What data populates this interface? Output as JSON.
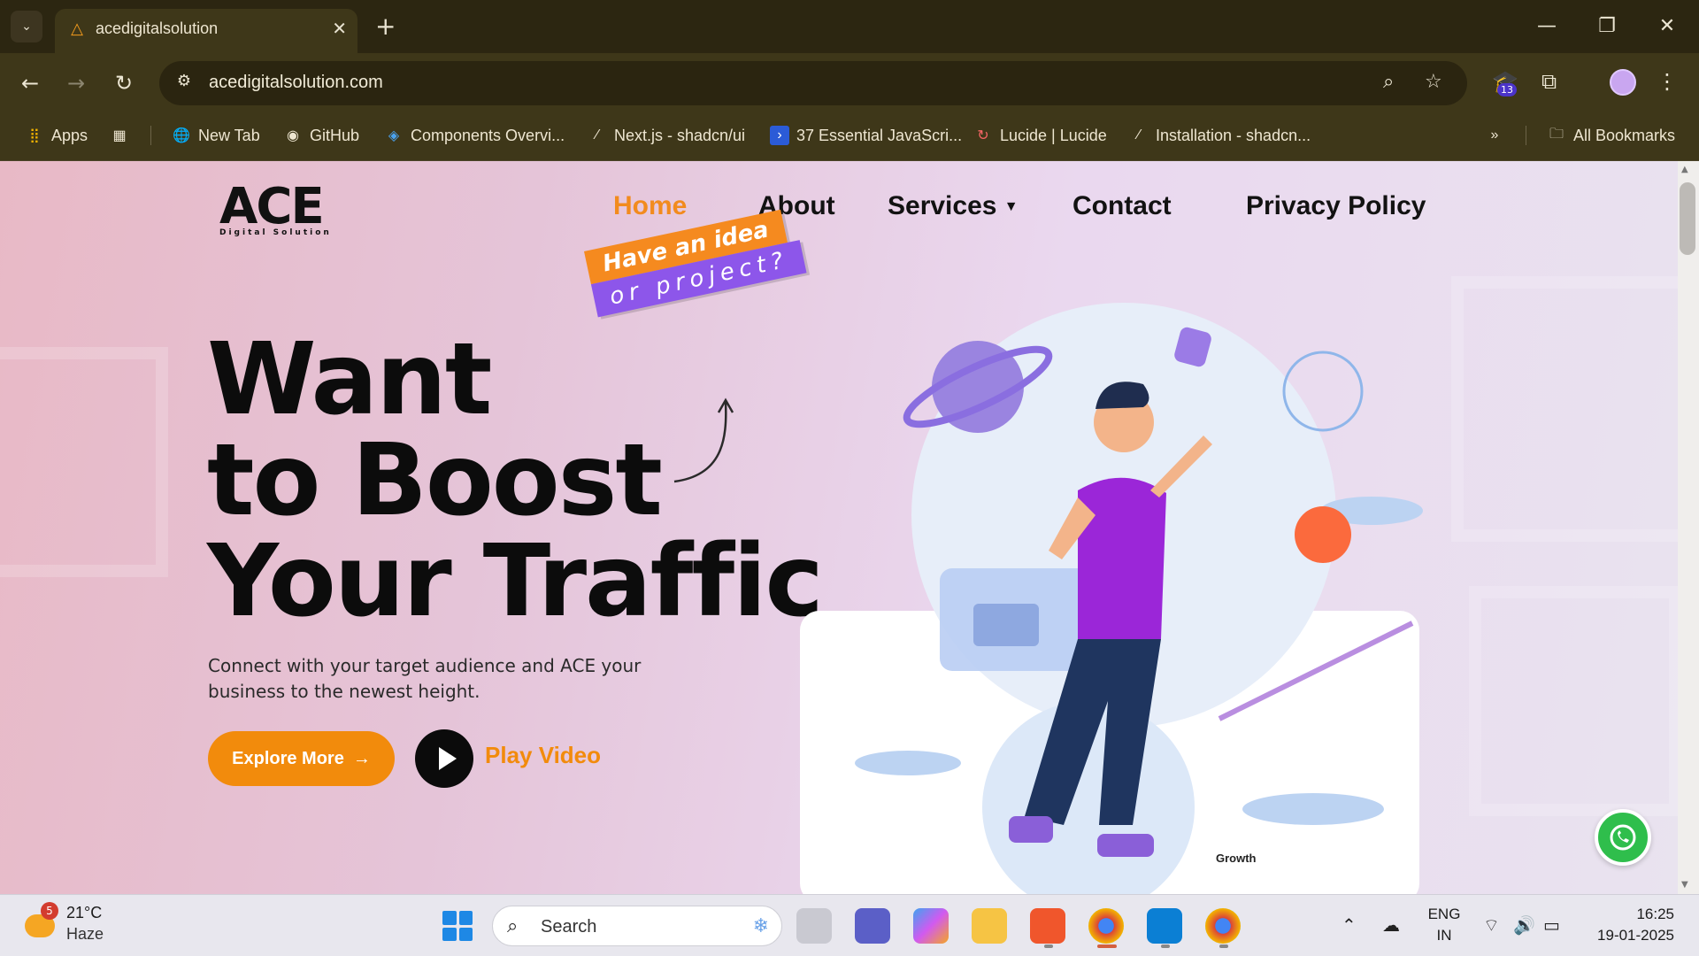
{
  "browser": {
    "tab_title": "acedigitalsolution",
    "url": "acedigitalsolution.com",
    "extension_badge": "13",
    "bookmarks": [
      {
        "label": "Apps"
      },
      {
        "label": "New Tab"
      },
      {
        "label": "GitHub"
      },
      {
        "label": "Components Overvi..."
      },
      {
        "label": "Next.js - shadcn/ui"
      },
      {
        "label": "37 Essential JavaScri..."
      },
      {
        "label": "Lucide | Lucide"
      },
      {
        "label": "Installation - shadcn..."
      }
    ],
    "all_bookmarks": "All Bookmarks"
  },
  "site": {
    "logo_main": "ACE",
    "logo_sub": "Digital Solution",
    "nav": [
      "Home",
      "About",
      "Services",
      "Contact",
      "Privacy Policy"
    ],
    "badge_line1": "Have an idea",
    "badge_line2": "or project?",
    "hero_line1": "Want",
    "hero_line2": "to Boost",
    "hero_line3": "Your Traffic",
    "hero_desc": "Connect with your target audience and ACE your business to the newest height.",
    "explore_btn": "Explore More",
    "play_label": "Play Video",
    "illustration_label": "Growth",
    "colors": {
      "accent": "#f28b0c",
      "purple": "#8d56ea"
    }
  },
  "taskbar": {
    "weather_temp": "21°C",
    "weather_cond": "Haze",
    "weather_badge": "5",
    "search_placeholder": "Search",
    "lang_line1": "ENG",
    "lang_line2": "IN",
    "time": "16:25",
    "date": "19-01-2025"
  }
}
